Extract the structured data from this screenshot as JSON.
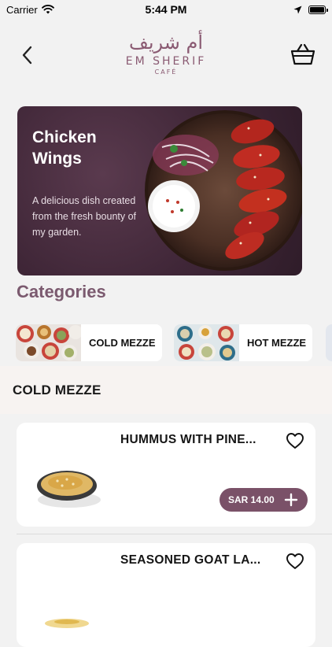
{
  "status_bar": {
    "carrier": "Carrier",
    "time": "5:44 PM"
  },
  "brand": {
    "arabic": "أم شريف",
    "name": "EM SHERIF",
    "sub": "CAFÉ",
    "accent_color": "#8a5a72"
  },
  "banner": {
    "title": "Chicken Wings",
    "description": "A delicious dish created from the fresh bounty of my garden."
  },
  "categories": {
    "heading": "Categories",
    "items": [
      {
        "label": "COLD MEZZE"
      },
      {
        "label": "HOT MEZZE"
      }
    ]
  },
  "section": {
    "title": "COLD MEZZE"
  },
  "products": [
    {
      "name": "HUMMUS WITH PINE...",
      "price": "SAR 14.00",
      "icon": "heart-outline-icon"
    },
    {
      "name": "SEASONED GOAT LA...",
      "icon": "heart-outline-icon"
    }
  ],
  "colors": {
    "price_pill": "#7a5168",
    "categories_heading": "#7b5a6f",
    "section_band": "#f7f3f1"
  }
}
